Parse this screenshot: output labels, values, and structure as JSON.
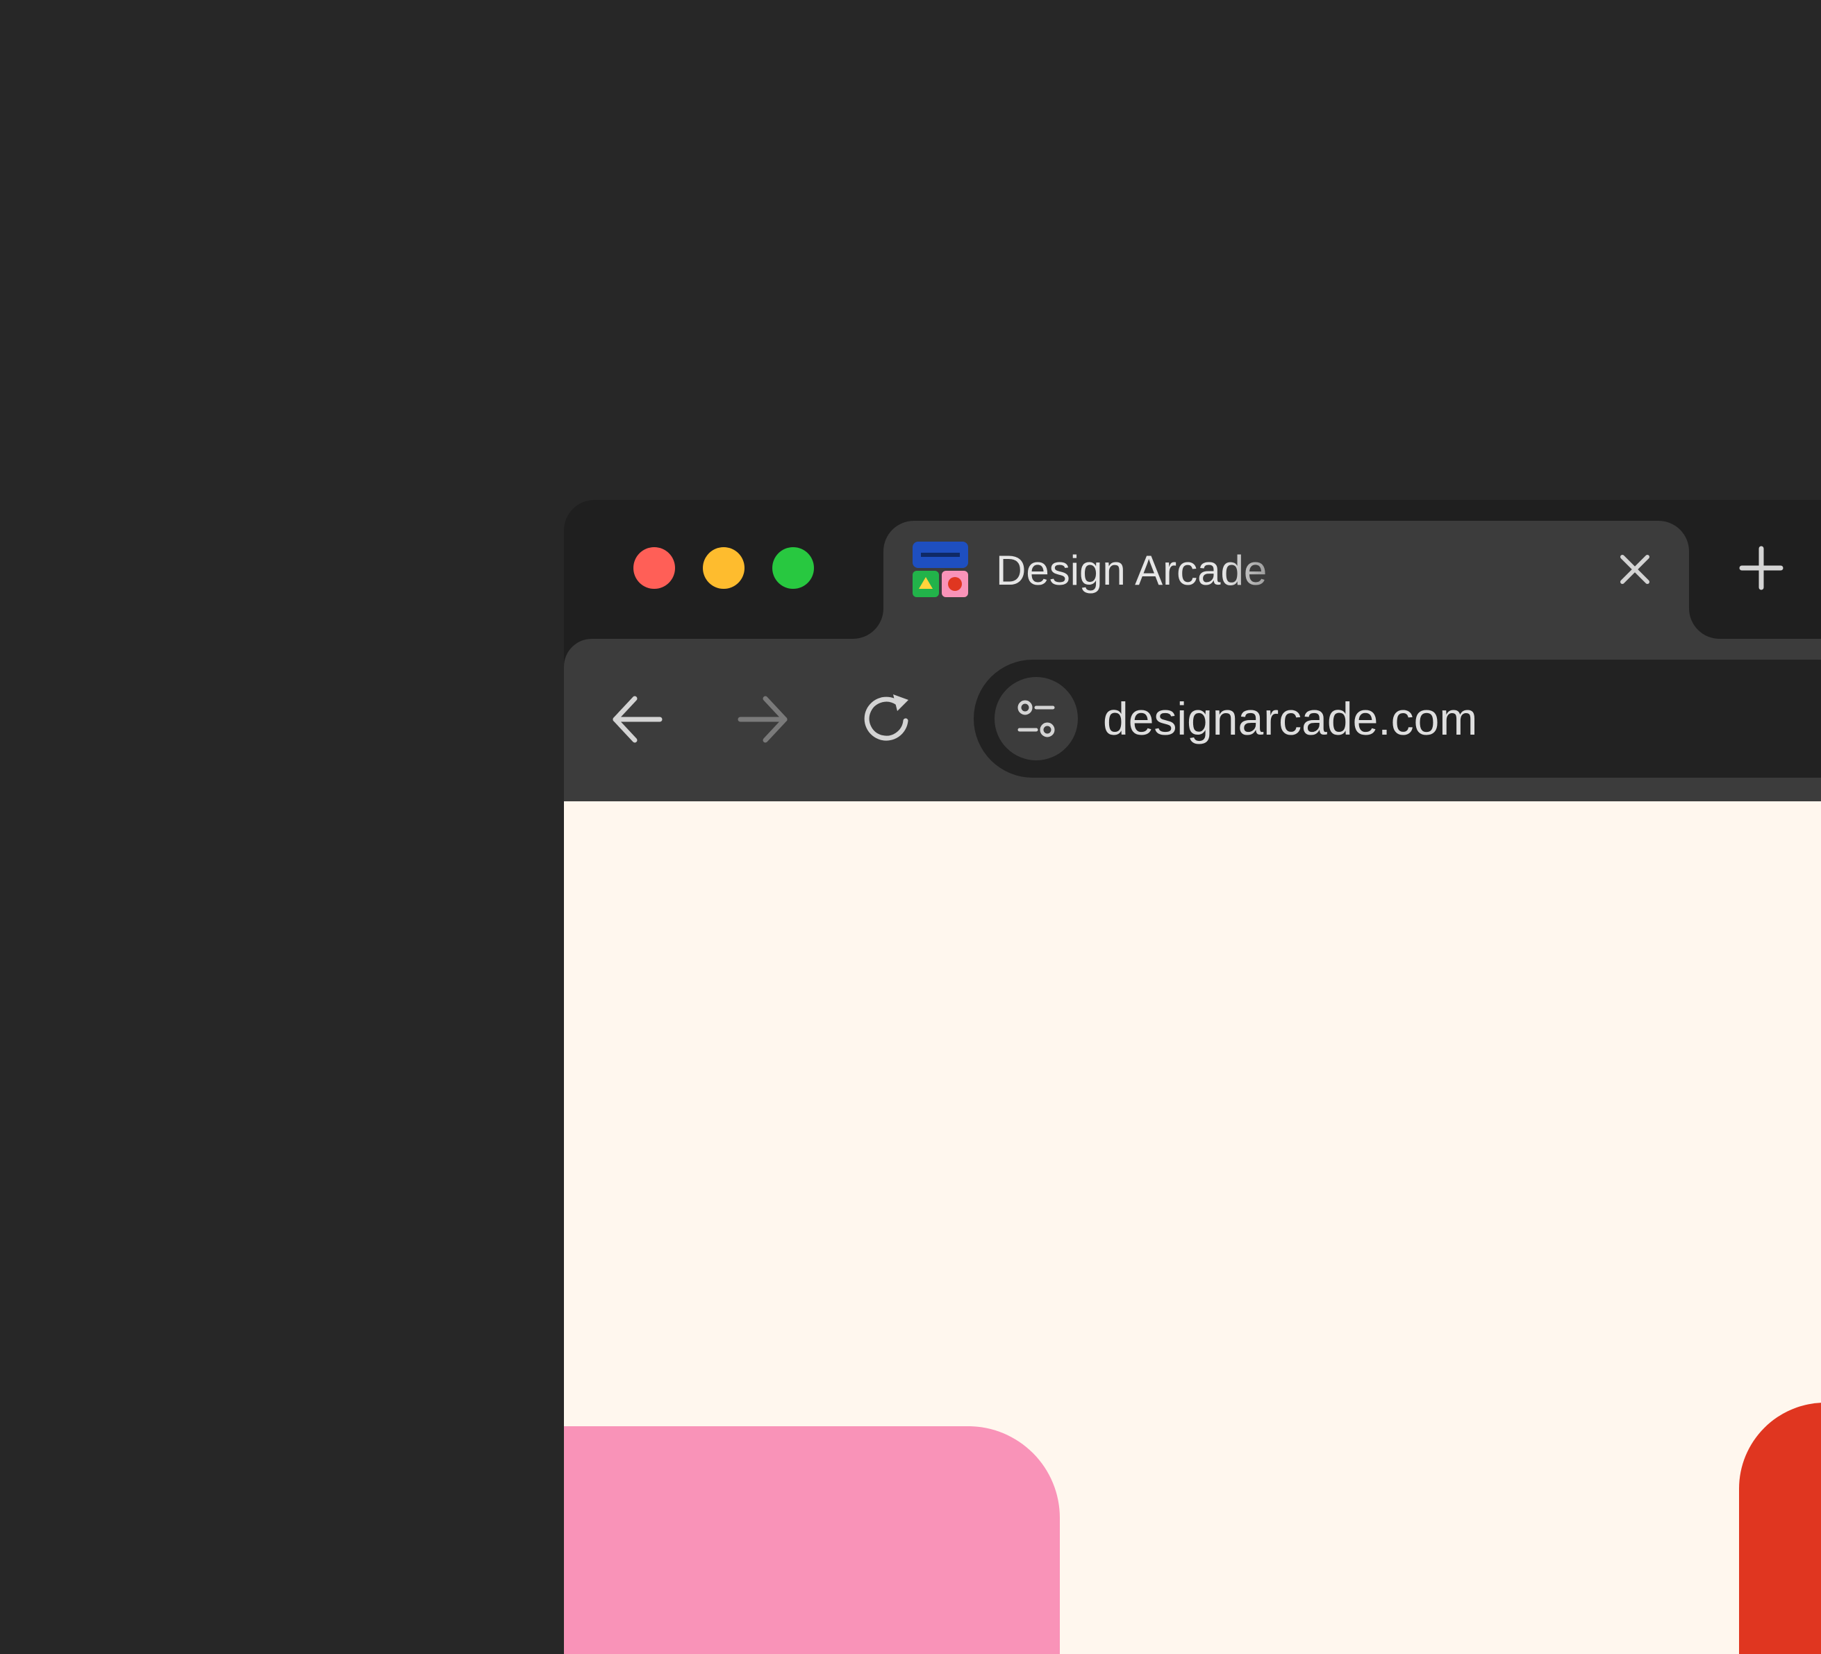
{
  "window": {
    "controls": {
      "close_color": "#ff5f57",
      "minimize_color": "#febc2e",
      "maximize_color": "#28c840"
    }
  },
  "tab": {
    "title": "Design Arcade",
    "favicon": "design-arcade-logo",
    "close_icon": "close-icon"
  },
  "new_tab": {
    "icon": "plus-icon"
  },
  "toolbar": {
    "back_icon": "arrow-left-icon",
    "forward_icon": "arrow-right-icon",
    "reload_icon": "reload-icon",
    "site_info_icon": "sliders-icon",
    "url": "designarcade.com"
  },
  "page": {
    "background": "#fff7ee",
    "shape_colors": [
      "#f993b8",
      "#e03620"
    ]
  }
}
